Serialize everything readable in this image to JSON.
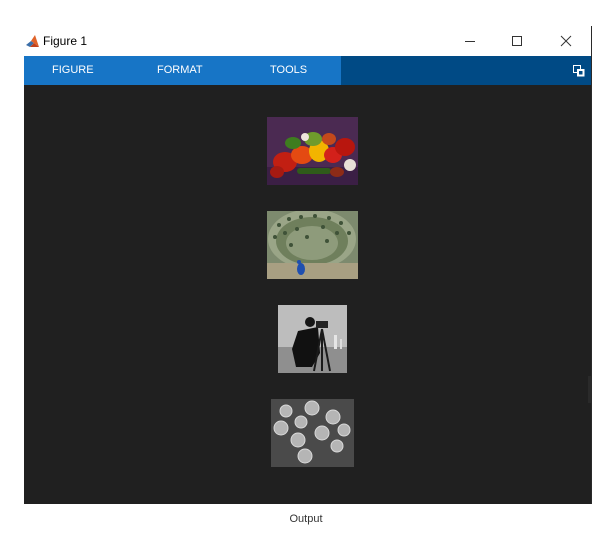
{
  "window": {
    "title": "Figure 1",
    "minimize_icon": "minimize-icon",
    "maximize_icon": "maximize-icon",
    "close_icon": "close-icon"
  },
  "toolstrip": {
    "tabs": [
      {
        "label": "FIGURE"
      },
      {
        "label": "FORMAT"
      },
      {
        "label": "TOOLS"
      }
    ],
    "undock_icon": "undock-icon",
    "accent_color": "#1775c6",
    "band_color": "#004a85"
  },
  "figure": {
    "background": "#202020",
    "images": [
      {
        "name": "peppers"
      },
      {
        "name": "peacock"
      },
      {
        "name": "cameraman"
      },
      {
        "name": "coins"
      }
    ]
  },
  "caption": "Output"
}
